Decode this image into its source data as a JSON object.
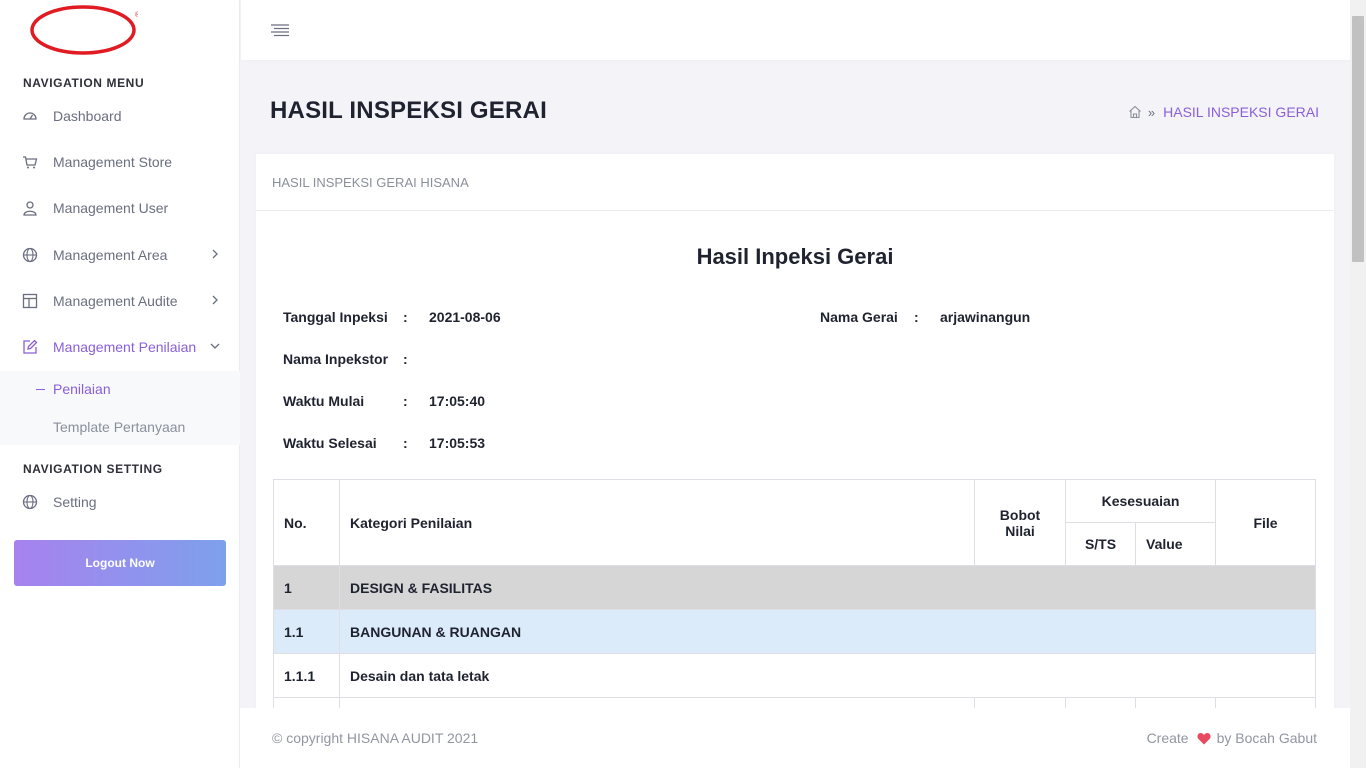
{
  "sidebar": {
    "heading_nav": "NAVIGATION MENU",
    "items": [
      {
        "label": "Dashboard",
        "icon": "dashboard-gauge-icon"
      },
      {
        "label": "Management Store",
        "icon": "cart-icon"
      },
      {
        "label": "Management User",
        "icon": "user-icon"
      },
      {
        "label": "Management Area",
        "icon": "globe-icon",
        "expandable": true
      },
      {
        "label": "Management Audite",
        "icon": "layout-icon",
        "expandable": true
      },
      {
        "label": "Management Penilaian",
        "icon": "edit-icon",
        "expandable": true,
        "active": true
      }
    ],
    "submenu": [
      {
        "label": "Penilaian",
        "active": true
      },
      {
        "label": "Template Pertanyaan"
      }
    ],
    "heading_setting": "NAVIGATION SETTING",
    "setting": {
      "label": "Setting",
      "icon": "globe-icon"
    },
    "logout": "Logout Now",
    "logo_mark": "®"
  },
  "header": {
    "title": "HASIL INSPEKSI GERAI",
    "breadcrumb": "HASIL INSPEKSI GERAI"
  },
  "card": {
    "title": "HASIL INSPEKSI GERAI HISANA",
    "report_title": "Hasil Inpeksi Gerai",
    "colon": ":",
    "info": {
      "tanggal_label": "Tanggal Inpeksi",
      "tanggal_value": "2021-08-06",
      "gerai_label": "Nama Gerai",
      "gerai_value": "arjawinangun",
      "inspektor_label": "Nama Inpekstor",
      "inspektor_value": "",
      "mulai_label": "Waktu Mulai",
      "mulai_value": "17:05:40",
      "selesai_label": "Waktu Selesai",
      "selesai_value": "17:05:53"
    },
    "table": {
      "headers": {
        "no": "No.",
        "kategori": "Kategori Penilaian",
        "bobot": "Bobot Nilai",
        "kesesuaian": "Kesesuaian",
        "sts": "S/TS",
        "value": "Value",
        "file": "File"
      },
      "rows": [
        {
          "no": "1",
          "kategori": "DESIGN & FASILITAS"
        },
        {
          "no": "1.1",
          "kategori": "BANGUNAN & RUANGAN"
        },
        {
          "no": "1.1.1",
          "kategori": "Desain dan tata letak"
        }
      ]
    }
  },
  "footer": {
    "copyright": "© copyright HISANA AUDIT 2021",
    "create": "Create",
    "by": "by Bocah Gabut"
  },
  "colors": {
    "accent": "#8a5fd8",
    "logo_red": "#e01b22",
    "heart": "#e84a5f",
    "row_category": "#d6d6d6",
    "row_subcategory": "#dcebf9"
  }
}
